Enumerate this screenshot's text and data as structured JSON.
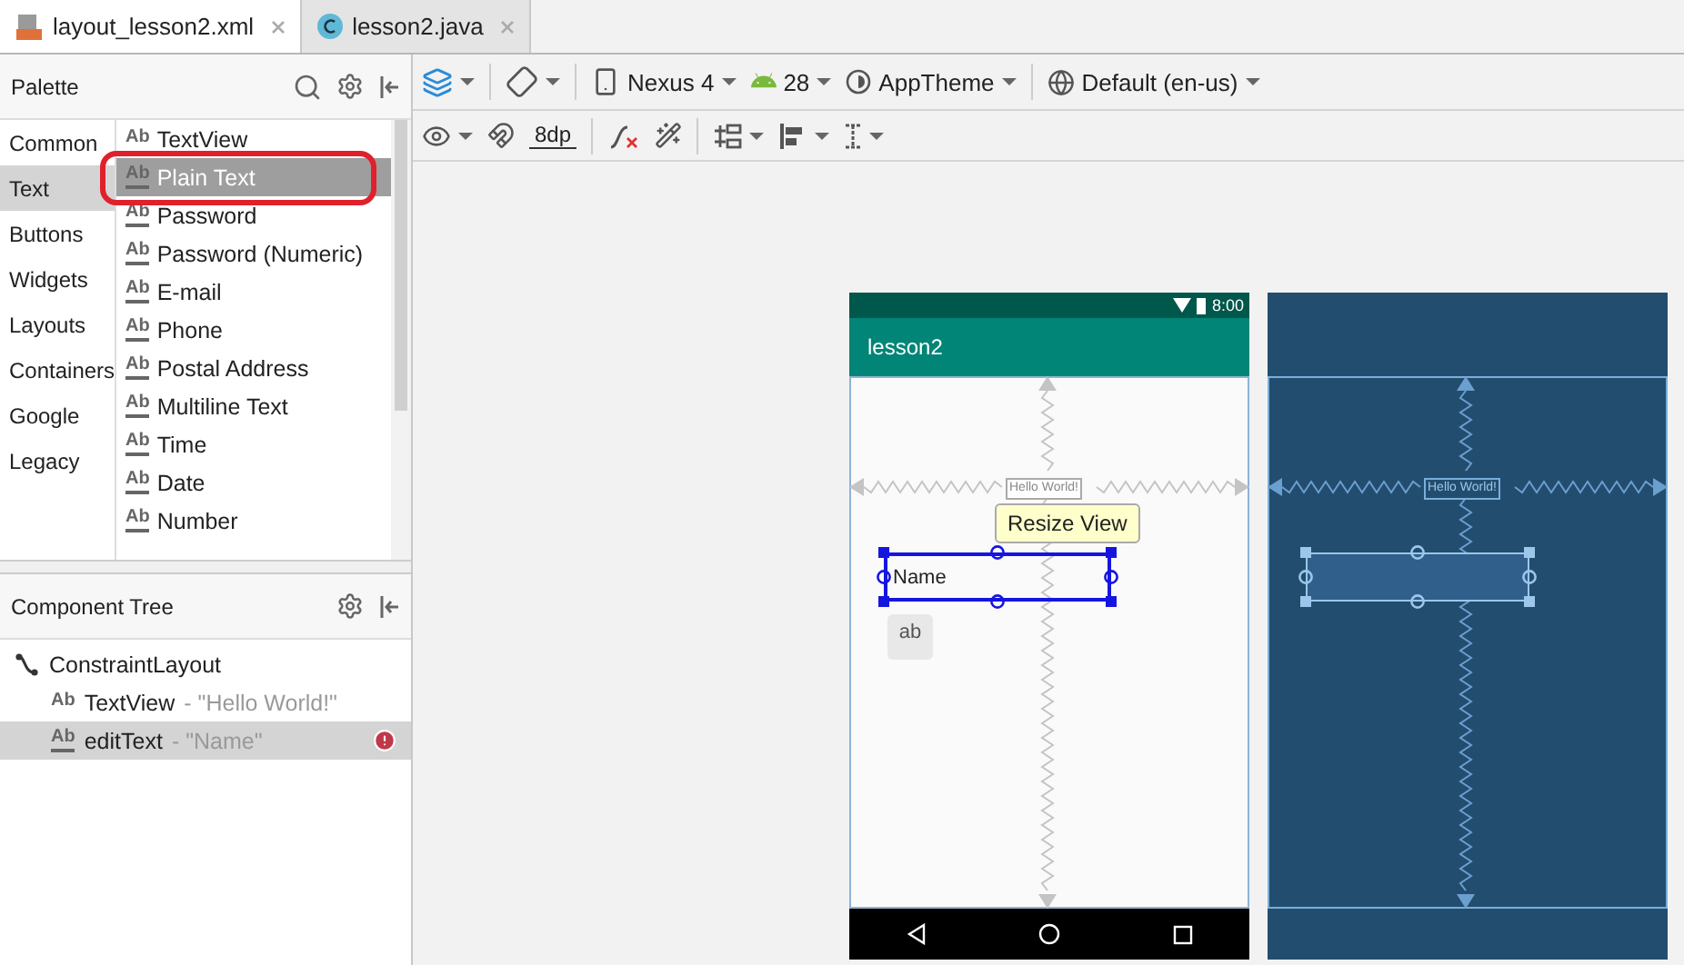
{
  "tabs": [
    {
      "label": "layout_lesson2.xml",
      "kind": "xml",
      "selected": true
    },
    {
      "label": "lesson2.java",
      "kind": "java",
      "selected": false
    }
  ],
  "palette": {
    "title": "Palette",
    "categories": [
      {
        "label": "Common",
        "selected": false
      },
      {
        "label": "Text",
        "selected": true
      },
      {
        "label": "Buttons",
        "selected": false
      },
      {
        "label": "Widgets",
        "selected": false
      },
      {
        "label": "Layouts",
        "selected": false
      },
      {
        "label": "Containers",
        "selected": false
      },
      {
        "label": "Google",
        "selected": false
      },
      {
        "label": "Legacy",
        "selected": false
      }
    ],
    "items": [
      {
        "label": "TextView",
        "icon": "Ab",
        "kind": "plain",
        "selected": false
      },
      {
        "label": "Plain Text",
        "icon": "Ab",
        "kind": "edit",
        "selected": true
      },
      {
        "label": "Password",
        "icon": "Ab",
        "kind": "edit",
        "selected": false
      },
      {
        "label": "Password (Numeric)",
        "icon": "Ab",
        "kind": "edit",
        "selected": false
      },
      {
        "label": "E-mail",
        "icon": "Ab",
        "kind": "edit",
        "selected": false
      },
      {
        "label": "Phone",
        "icon": "Ab",
        "kind": "edit",
        "selected": false
      },
      {
        "label": "Postal Address",
        "icon": "Ab",
        "kind": "edit",
        "selected": false
      },
      {
        "label": "Multiline Text",
        "icon": "Ab",
        "kind": "edit",
        "selected": false
      },
      {
        "label": "Time",
        "icon": "Ab",
        "kind": "edit",
        "selected": false
      },
      {
        "label": "Date",
        "icon": "Ab",
        "kind": "edit",
        "selected": false
      },
      {
        "label": "Number",
        "icon": "Ab",
        "kind": "edit",
        "selected": false
      }
    ]
  },
  "component_tree": {
    "title": "Component Tree",
    "items": [
      {
        "name": "ConstraintLayout",
        "kind": "layout",
        "selected": false,
        "error": false,
        "children": [
          {
            "name": "TextView",
            "value": "- \"Hello World!\"",
            "icon": "Ab",
            "kind": "plain",
            "selected": false,
            "error": false
          },
          {
            "name": "editText",
            "value": "- \"Name\"",
            "icon": "Ab",
            "kind": "edit",
            "selected": true,
            "error": true
          }
        ]
      }
    ]
  },
  "toolbar": {
    "device": "Nexus 4",
    "api": "28",
    "theme": "AppTheme",
    "locale": "Default (en-us)",
    "margin": "8dp"
  },
  "design": {
    "time": "8:00",
    "app_title": "lesson2",
    "hello": "Hello World!",
    "field": "Name",
    "tooltip": "Resize View",
    "badge": "ab",
    "blueprint_hello": "Hello World!"
  }
}
